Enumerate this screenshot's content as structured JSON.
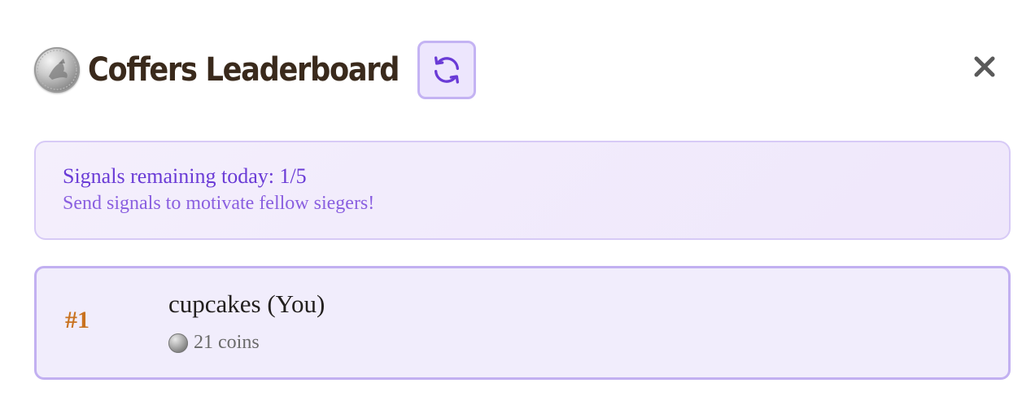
{
  "header": {
    "title": "Coffers Leaderboard",
    "coin_icon": "silver-coin-icon",
    "refresh_icon": "refresh-icon",
    "close_icon": "close-icon"
  },
  "signals": {
    "remaining_text": "Signals remaining today: 1/5",
    "hint_text": "Send signals to motivate fellow siegers!"
  },
  "leaderboard": {
    "entries": [
      {
        "rank": "#1",
        "name": "cupcakes (You)",
        "coins": "21 coins"
      }
    ]
  },
  "colors": {
    "title": "#3a2a1c",
    "accent": "#6a3bd6",
    "rank": "#c9721f",
    "card_border": "#c2b0f1",
    "card_bg": "#f1edfc"
  }
}
